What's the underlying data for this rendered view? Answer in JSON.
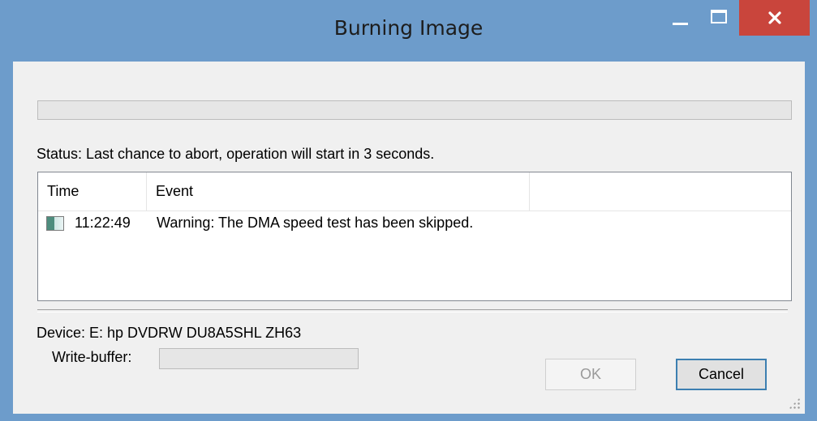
{
  "window": {
    "title": "Burning Image",
    "controls": {
      "minimize_icon": "minimize-icon",
      "maximize_icon": "maximize-icon",
      "close_icon": "close-icon",
      "close_color": "#c9453c"
    },
    "frame_color": "#6d9ccb"
  },
  "main": {
    "progress_percent": 0,
    "status": "Status: Last chance to abort, operation will start in 3 seconds.",
    "log": {
      "columns": [
        "Time",
        "Event"
      ],
      "rows": [
        {
          "icon": "info-log-icon",
          "time": "11:22:49",
          "event": "Warning: The DMA speed test has been skipped."
        }
      ]
    },
    "device": "Device: E: hp DVDRW  DU8A5SHL ZH63",
    "write_buffer_label": "Write-buffer:",
    "write_buffer_percent": 0
  },
  "buttons": {
    "ok": "OK",
    "cancel": "Cancel"
  }
}
